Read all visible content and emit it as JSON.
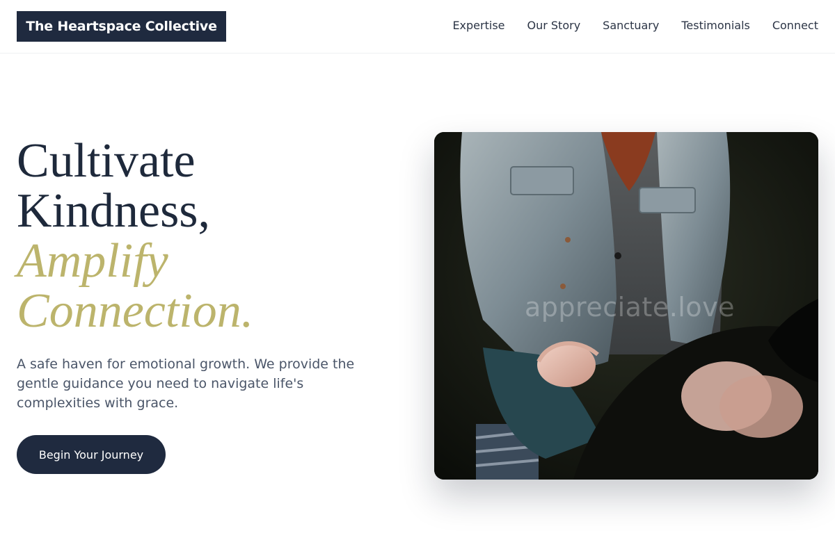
{
  "brand": {
    "name": "The Heartspace Collective",
    "color_dark": "#1f2a3f",
    "color_accent": "#bcb46c"
  },
  "nav": {
    "items": [
      "Expertise",
      "Our Story",
      "Sanctuary",
      "Testimonials",
      "Connect"
    ]
  },
  "hero": {
    "headline_line1": "Cultivate",
    "headline_line2": "Kindness,",
    "headline_line3": "Amplify",
    "headline_line4": "Connection.",
    "subtitle": "A safe haven for emotional growth. We provide the gentle guidance you need to navigate life's complexities with grace.",
    "cta_label": "Begin Your Journey"
  },
  "photo": {
    "watermark": "appreciate.love"
  }
}
